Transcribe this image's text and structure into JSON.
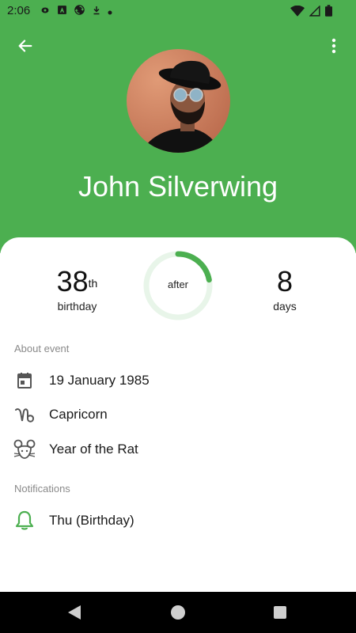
{
  "status_bar": {
    "time": "2:06",
    "icons_left": [
      "gear-icon",
      "a-icon",
      "sync-icon",
      "download-icon",
      "dot-icon"
    ],
    "icons_right": [
      "wifi-icon",
      "signal-icon",
      "battery-icon"
    ]
  },
  "header": {
    "name": "John Silverwing",
    "background_color": "#4caf50",
    "icons": [
      "arrow-back-icon",
      "more-vert-icon"
    ]
  },
  "stats": {
    "age_number": "38",
    "age_suffix": "th",
    "age_label": "birthday",
    "ring_label": "after",
    "ring_progress": 0.22,
    "days_number": "8",
    "days_label": "days"
  },
  "about": {
    "section_label": "About event",
    "items": [
      {
        "icon": "calendar-icon",
        "text": "19 January 1985"
      },
      {
        "icon": "capricorn-icon",
        "text": "Capricorn"
      },
      {
        "icon": "rat-icon",
        "text": "Year of the Rat"
      }
    ]
  },
  "notifications": {
    "section_label": "Notifications",
    "items": [
      {
        "icon": "bell-icon",
        "text": "Thu (Birthday)"
      }
    ]
  },
  "nav_bar": {
    "icons": [
      "nav-back-icon",
      "nav-home-icon",
      "nav-recents-icon"
    ]
  },
  "colors": {
    "accent": "#4caf50",
    "ring_track": "#e8f5e9",
    "text_primary": "#1a1a1a",
    "text_secondary": "#8a8a8a"
  }
}
